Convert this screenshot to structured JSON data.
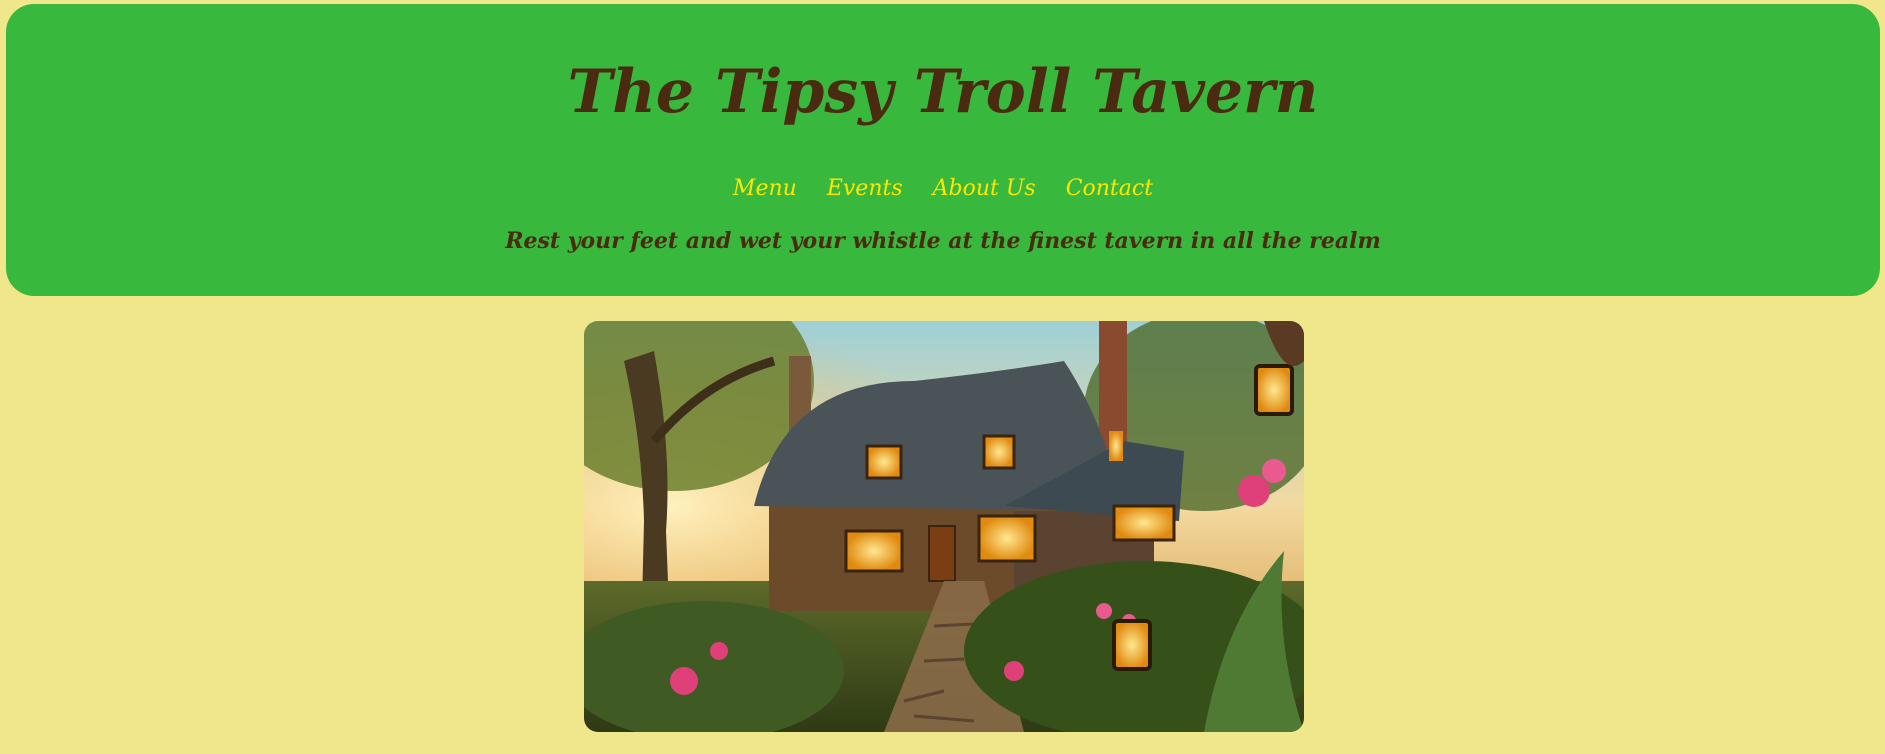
{
  "header": {
    "title": "The Tipsy Troll Tavern",
    "tagline": "Rest your feet and wet your whistle at the finest tavern in all the realm",
    "background_color": "#38b83c",
    "title_color": "#4a2a10",
    "nav_color": "#ffe600"
  },
  "nav": {
    "items": [
      {
        "label": "Menu"
      },
      {
        "label": "Events"
      },
      {
        "label": "About Us"
      },
      {
        "label": "Contact"
      }
    ]
  },
  "page": {
    "background_color": "#f0e68c"
  },
  "hero_image": {
    "icon": "tavern-cottage-illustration"
  }
}
